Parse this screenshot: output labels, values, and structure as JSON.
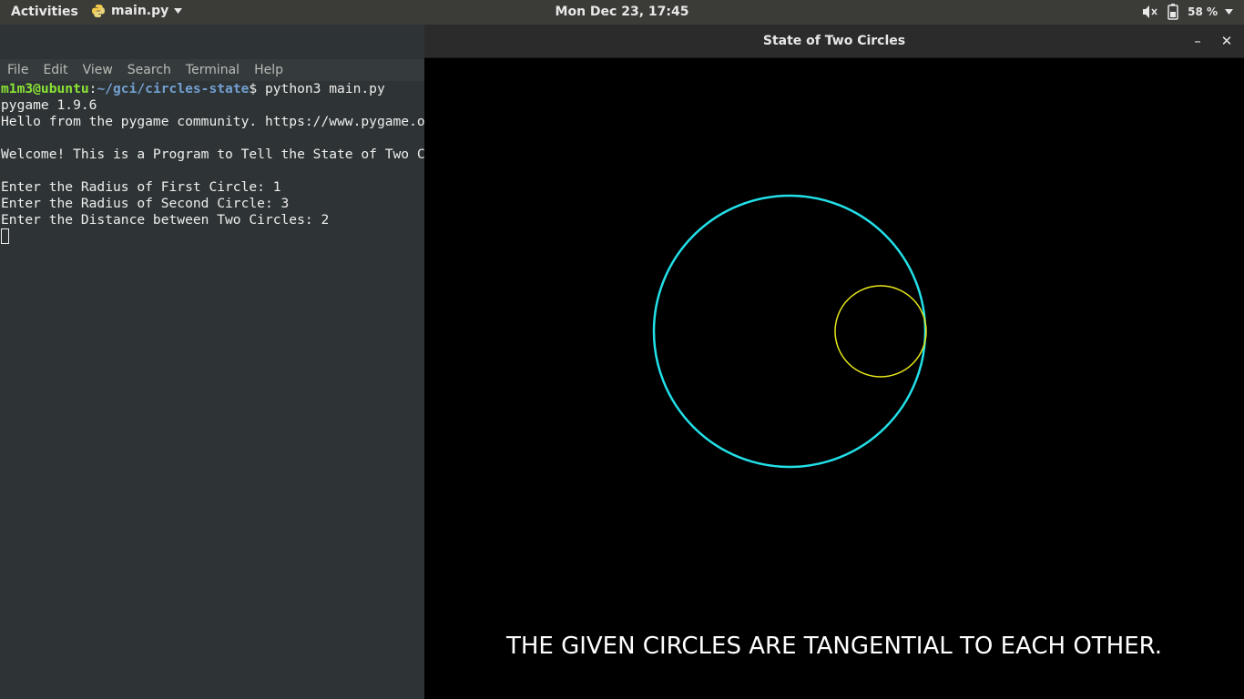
{
  "topbar": {
    "activities": "Activities",
    "app_name": "main.py",
    "clock": "Mon Dec 23, 17:45",
    "battery": "58 %"
  },
  "terminal": {
    "menu": [
      "File",
      "Edit",
      "View",
      "Search",
      "Terminal",
      "Help"
    ],
    "prompt_user": "m1m3@ubuntu",
    "prompt_sep": ":",
    "prompt_path": "~/gci/circles-state",
    "prompt_cmd": "$ python3 main.py",
    "lines": [
      "pygame 1.9.6",
      "Hello from the pygame community. https://www.pygame.org/contribute.html",
      "",
      "Welcome! This is a Program to Tell the State of Two Circles",
      "",
      "Enter the Radius of First Circle: 1",
      "Enter the Radius of Second Circle: 3",
      "Enter the Distance between Two Circles: 2"
    ]
  },
  "window": {
    "title": "State of Two Circles",
    "minimize": "–",
    "close": "✕",
    "result": "THE GIVEN CIRCLES ARE TANGENTIAL TO EACH OTHER.",
    "circles": {
      "big": {
        "radius": 3,
        "color": "#22e0e8"
      },
      "small": {
        "radius": 1,
        "color": "#e8e81a"
      },
      "distance": 2
    }
  }
}
